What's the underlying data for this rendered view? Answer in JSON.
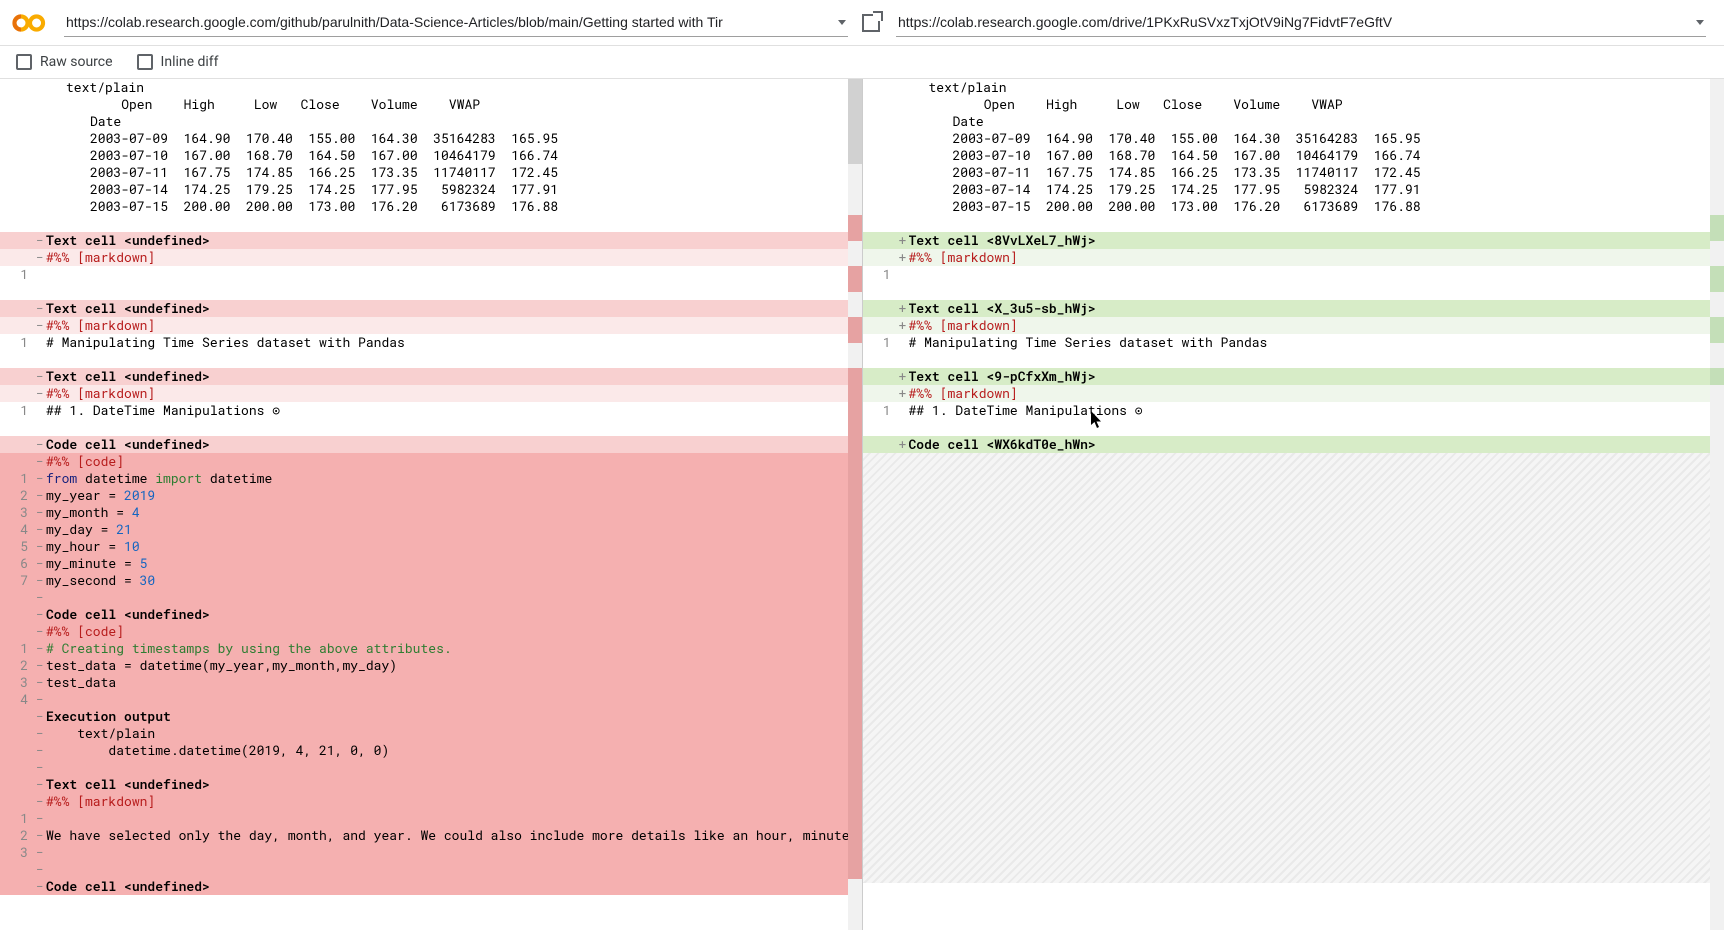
{
  "urls": {
    "left": "https://colab.research.google.com/github/parulnith/Data-Science-Articles/blob/main/Getting started with Tir",
    "right": "https://colab.research.google.com/drive/1PKxRuSVxzTxjOtV9iNg7FidvtF7eGftV"
  },
  "controls": {
    "raw_source": "Raw source",
    "inline_diff": "Inline diff"
  },
  "output_head": {
    "textplain": "text/plain",
    "cols": "    Open    High     Low   Close    Volume    VWAP",
    "date": "Date",
    "rows": [
      "2003-07-09  164.90  170.40  155.00  164.30  35164283  165.95",
      "2003-07-10  167.00  168.70  164.50  167.00  10464179  166.74",
      "2003-07-11  167.75  174.85  166.25  173.35  11740117  172.45",
      "2003-07-14  174.25  179.25  174.25  177.95   5982324  177.91",
      "2003-07-15  200.00  200.00  173.00  176.20   6173689  176.88"
    ]
  },
  "left": {
    "cell1": "Text cell <undefined>",
    "cell2": "Text cell <undefined>",
    "cell3": "Text cell <undefined>",
    "cell4": "Code cell <undefined>",
    "cell5": "Code cell <undefined>",
    "cell6": "Text cell <undefined>",
    "cell7": "Code cell <undefined>",
    "markdown_tag": "#%% [markdown]",
    "code_tag": "#%% [code]",
    "md_line1": "# Manipulating Time Series dataset with Pandas",
    "md_line2": "## 1. DateTime Manipulations ⊙",
    "code1": {
      "l1a": "from",
      "l1b": " datetime ",
      "l1c": "import",
      "l1d": " datetime",
      "l2a": "my_year = ",
      "l2b": "2019",
      "l3a": "my_month = ",
      "l3b": "4",
      "l4a": "my_day = ",
      "l4b": "21",
      "l5a": "my_hour = ",
      "l5b": "10",
      "l6a": "my_minute = ",
      "l6b": "5",
      "l7a": "my_second = ",
      "l7b": "30"
    },
    "code2": {
      "c1": "# Creating timestamps by using the above attributes.",
      "c2": "test_data = datetime(my_year,my_month,my_day)",
      "c3": "test_data"
    },
    "exec_hdr": "Execution output",
    "exec1": "    text/plain",
    "exec2": "        datetime.datetime(2019, 4, 21, 0, 0)",
    "md2": "We have selected only the day, month, and year. We could also include more details like an hour, minute, and secon"
  },
  "right": {
    "cell1": "Text cell <8VvLXeL7_hWj>",
    "cell2": "Text cell <X_3u5-sb_hWj>",
    "cell3": "Text cell <9-pCfxXm_hWj>",
    "cell4": "Code cell <WX6kdT0e_hWn>",
    "markdown_tag": "#%% [markdown]",
    "md_line1": "# Manipulating Time Series dataset with Pandas",
    "md_line2": "## 1. DateTime Manipulations ⊙"
  }
}
